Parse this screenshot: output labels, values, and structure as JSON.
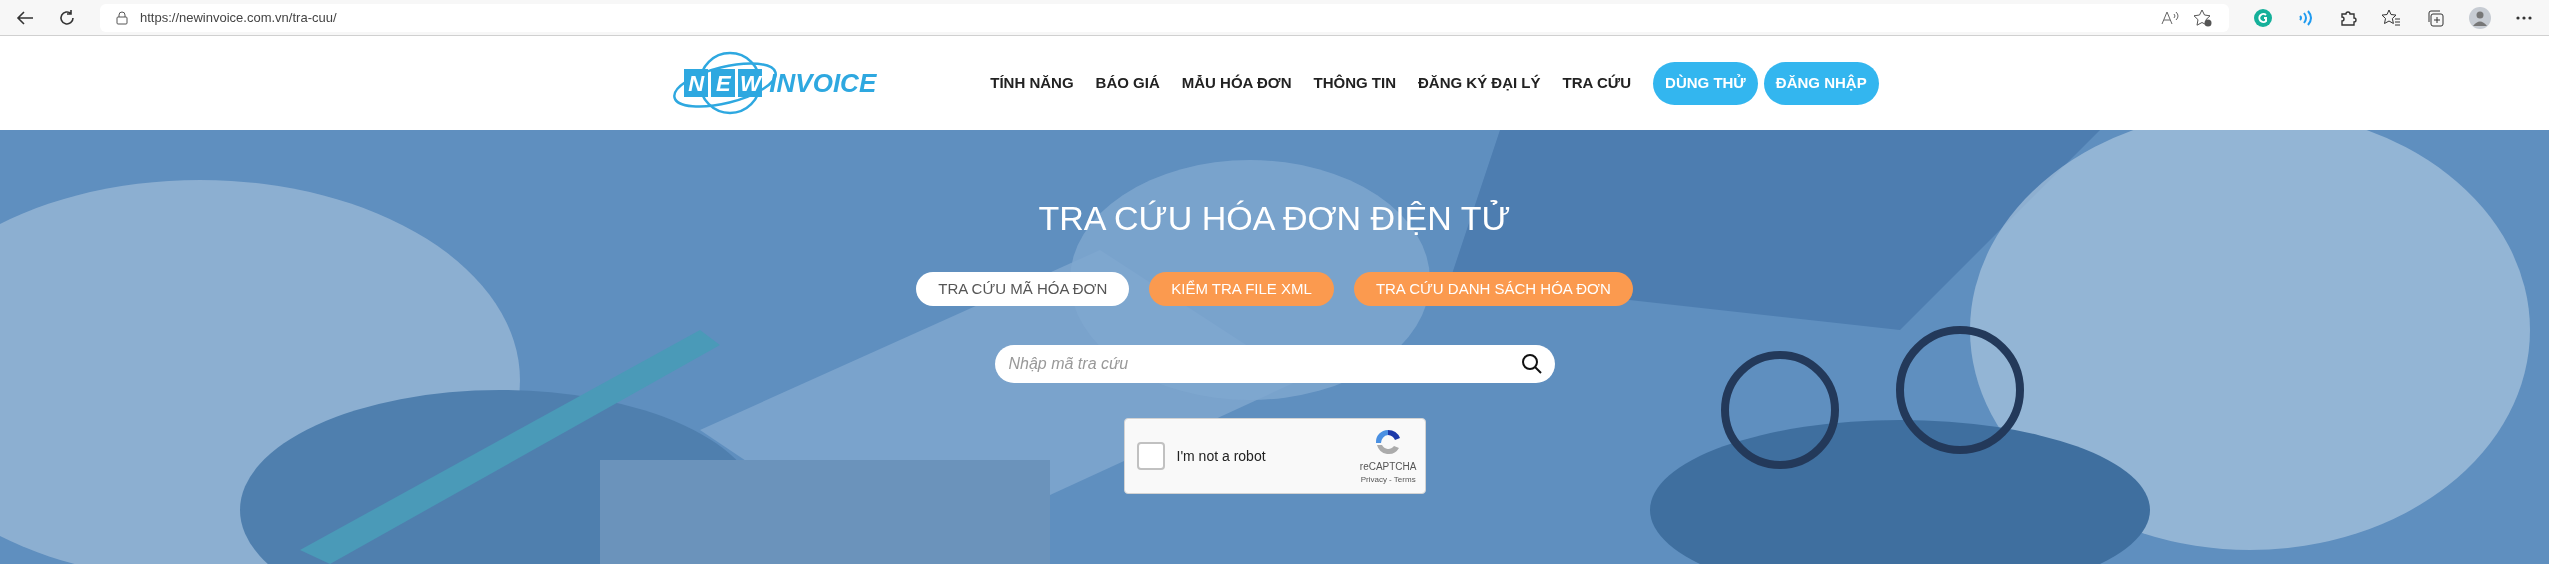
{
  "browser": {
    "url": "https://newinvoice.com.vn/tra-cuu/"
  },
  "logo": {
    "boxed_letters": [
      "N",
      "E",
      "W"
    ],
    "word": "INVOICE"
  },
  "nav": {
    "links": [
      "TÍNH NĂNG",
      "BÁO GIÁ",
      "MẪU HÓA ĐƠN",
      "THÔNG TIN",
      "ĐĂNG KÝ ĐẠI LÝ",
      "TRA CỨU"
    ],
    "buttons": [
      "DÙNG THỬ",
      "ĐĂNG NHẬP"
    ]
  },
  "hero": {
    "title": "TRA CỨU HÓA ĐƠN ĐIỆN TỬ",
    "tabs": [
      {
        "label": "TRA CỨU MÃ HÓA ĐƠN",
        "selected": true
      },
      {
        "label": "KIỂM TRA FILE XML",
        "selected": false
      },
      {
        "label": "TRA CỨU DANH SÁCH HÓA ĐƠN",
        "selected": false
      }
    ],
    "search": {
      "placeholder": "Nhập mã tra cứu"
    },
    "captcha": {
      "label": "I'm not a robot",
      "checked": false,
      "brand": "reCAPTCHA",
      "links": "Privacy - Terms"
    }
  }
}
